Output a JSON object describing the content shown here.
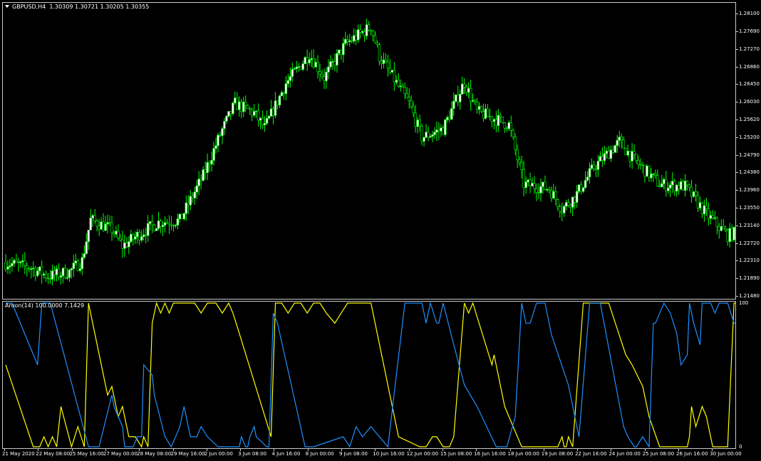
{
  "main_window": {
    "symbol_label": "GBPUSD,H4",
    "ohlc_label": "1.30309 1.30721 1.30205 1.30355"
  },
  "indicator_window": {
    "label": "Aroon(14) 100.0000 7.1429"
  },
  "colors": {
    "background": "#000000",
    "frame": "#c8c8c8",
    "bull_candle": "#ffffff",
    "bear_candle": "#000000",
    "candle_wick": "#00ff00",
    "aroon_up": "#ffff00",
    "aroon_down": "#1e90ff",
    "text": "#ffffff"
  },
  "price_axis": {
    "labels": [
      "1.28100",
      "1.27690",
      "1.27270",
      "1.26860",
      "1.26450",
      "1.26030",
      "1.25620",
      "1.25200",
      "1.24790",
      "1.24380",
      "1.23960",
      "1.23550",
      "1.23140",
      "1.22720",
      "1.22310",
      "1.21890",
      "1.21480"
    ]
  },
  "indicator_axis": {
    "labels": [
      "100",
      "0"
    ]
  },
  "time_axis": {
    "labels": [
      "21 May 2020",
      "22 May 08:00",
      "25 May 16:00",
      "27 May 00:00",
      "28 May 08:00",
      "29 May 16:00",
      "2 Jun 00:00",
      "3 Jun 08:00",
      "4 Jun 16:00",
      "8 Jun 00:00",
      "9 Jun 08:00",
      "10 Jun 16:00",
      "12 Jun 00:00",
      "15 Jun 08:00",
      "16 Jun 16:00",
      "18 Jun 00:00",
      "19 Jun 08:00",
      "22 Jun 16:00",
      "24 Jun 00:00",
      "25 Jun 08:00",
      "26 Jun 16:00",
      "30 Jun 00:00"
    ]
  },
  "chart_data": [
    {
      "type": "candlestick",
      "symbol": "GBPUSD",
      "timeframe": "H4",
      "ylim": [
        1.2148,
        1.2829
      ],
      "anchors": [
        [
          0,
          1.2226
        ],
        [
          12,
          1.2214
        ],
        [
          20,
          1.2194
        ],
        [
          30,
          1.2205
        ],
        [
          36,
          1.2231
        ],
        [
          40,
          1.2327
        ],
        [
          50,
          1.2304
        ],
        [
          55,
          1.2265
        ],
        [
          62,
          1.229
        ],
        [
          72,
          1.2321
        ],
        [
          82,
          1.2325
        ],
        [
          93,
          1.243
        ],
        [
          102,
          1.2538
        ],
        [
          108,
          1.2599
        ],
        [
          117,
          1.2577
        ],
        [
          122,
          1.2542
        ],
        [
          132,
          1.2647
        ],
        [
          143,
          1.2716
        ],
        [
          150,
          1.266
        ],
        [
          160,
          1.2739
        ],
        [
          172,
          1.278
        ],
        [
          176,
          1.271
        ],
        [
          190,
          1.26
        ],
        [
          196,
          1.252
        ],
        [
          206,
          1.254
        ],
        [
          216,
          1.265
        ],
        [
          222,
          1.258
        ],
        [
          237,
          1.255
        ],
        [
          244,
          1.241
        ],
        [
          256,
          1.24
        ],
        [
          262,
          1.2352
        ],
        [
          268,
          1.238
        ],
        [
          277,
          1.245
        ],
        [
          289,
          1.251
        ],
        [
          296,
          1.2467
        ],
        [
          308,
          1.241
        ],
        [
          320,
          1.2405
        ],
        [
          330,
          1.234
        ],
        [
          340,
          1.229
        ],
        [
          344,
          1.2297
        ]
      ]
    },
    {
      "type": "line",
      "name": "Aroon(14)",
      "ylim": [
        0,
        100
      ],
      "current": {
        "up": 100.0,
        "down": 7.1429
      },
      "series": [
        {
          "name": "Aroon Up",
          "points": [
            [
              0,
              57
            ],
            [
              13,
              0
            ],
            [
              16,
              0
            ],
            [
              18,
              7
            ],
            [
              20,
              0
            ],
            [
              22,
              7
            ],
            [
              24,
              0
            ],
            [
              26,
              28
            ],
            [
              31,
              0
            ],
            [
              34,
              14
            ],
            [
              37,
              0
            ],
            [
              39,
              100
            ],
            [
              48,
              36
            ],
            [
              50,
              42
            ],
            [
              53,
              21
            ],
            [
              55,
              28
            ],
            [
              58,
              7
            ],
            [
              61,
              7
            ],
            [
              64,
              0
            ],
            [
              65,
              7
            ],
            [
              67,
              0
            ],
            [
              69,
              86
            ],
            [
              71,
              100
            ],
            [
              73,
              93
            ],
            [
              75,
              100
            ],
            [
              77,
              93
            ],
            [
              79,
              100
            ],
            [
              81,
              100
            ],
            [
              83,
              100
            ],
            [
              85,
              100
            ],
            [
              89,
              100
            ],
            [
              92,
              93
            ],
            [
              95,
              100
            ],
            [
              99,
              100
            ],
            [
              102,
              93
            ],
            [
              105,
              100
            ],
            [
              107,
              93
            ],
            [
              110,
              79
            ],
            [
              125,
              7
            ],
            [
              127,
              100
            ],
            [
              130,
              100
            ],
            [
              133,
              93
            ],
            [
              136,
              100
            ],
            [
              139,
              100
            ],
            [
              142,
              93
            ],
            [
              145,
              100
            ],
            [
              148,
              100
            ],
            [
              151,
              93
            ],
            [
              155,
              86
            ],
            [
              158,
              93
            ],
            [
              161,
              100
            ],
            [
              164,
              100
            ],
            [
              171,
              100
            ],
            [
              172,
              100
            ],
            [
              185,
              7
            ],
            [
              195,
              0
            ],
            [
              198,
              0
            ],
            [
              201,
              7
            ],
            [
              203,
              7
            ],
            [
              206,
              0
            ],
            [
              209,
              0
            ],
            [
              211,
              7
            ],
            [
              216,
              100
            ],
            [
              218,
              93
            ],
            [
              220,
              100
            ],
            [
              229,
              57
            ],
            [
              230,
              64
            ],
            [
              235,
              28
            ],
            [
              243,
              0
            ],
            [
              255,
              0
            ],
            [
              260,
              0
            ],
            [
              262,
              7
            ],
            [
              263,
              0
            ],
            [
              264,
              0
            ],
            [
              265,
              7
            ],
            [
              267,
              0
            ],
            [
              272,
              100
            ],
            [
              273,
              100
            ],
            [
              275,
              100
            ],
            [
              284,
              100
            ],
            [
              292,
              64
            ],
            [
              295,
              57
            ],
            [
              300,
              42
            ],
            [
              303,
              21
            ],
            [
              308,
              0
            ],
            [
              318,
              0
            ],
            [
              321,
              0
            ],
            [
              322,
              7
            ],
            [
              323,
              28
            ],
            [
              325,
              14
            ],
            [
              328,
              28
            ],
            [
              330,
              21
            ],
            [
              333,
              0
            ],
            [
              336,
              0
            ],
            [
              340,
              0
            ],
            [
              343,
              100
            ],
            [
              344,
              100
            ]
          ]
        },
        {
          "name": "Aroon Down",
          "points": [
            [
              0,
              100
            ],
            [
              3,
              100
            ],
            [
              15,
              57
            ],
            [
              17,
              100
            ],
            [
              21,
              100
            ],
            [
              39,
              0
            ],
            [
              44,
              0
            ],
            [
              50,
              36
            ],
            [
              51,
              28
            ],
            [
              55,
              14
            ],
            [
              56,
              0
            ],
            [
              60,
              0
            ],
            [
              62,
              7
            ],
            [
              64,
              7
            ],
            [
              65,
              57
            ],
            [
              69,
              50
            ],
            [
              70,
              36
            ],
            [
              75,
              7
            ],
            [
              78,
              0
            ],
            [
              82,
              14
            ],
            [
              84,
              28
            ],
            [
              87,
              7
            ],
            [
              90,
              7
            ],
            [
              92,
              14
            ],
            [
              95,
              7
            ],
            [
              100,
              0
            ],
            [
              102,
              0
            ],
            [
              106,
              0
            ],
            [
              110,
              0
            ],
            [
              111,
              7
            ],
            [
              113,
              0
            ],
            [
              114,
              0
            ],
            [
              115,
              7
            ],
            [
              117,
              14
            ],
            [
              118,
              7
            ],
            [
              123,
              0
            ],
            [
              124,
              0
            ],
            [
              126,
              93
            ],
            [
              128,
              86
            ],
            [
              141,
              0
            ],
            [
              145,
              0
            ],
            [
              159,
              7
            ],
            [
              162,
              0
            ],
            [
              165,
              14
            ],
            [
              168,
              7
            ],
            [
              172,
              14
            ],
            [
              180,
              0
            ],
            [
              188,
              100
            ],
            [
              192,
              100
            ],
            [
              196,
              100
            ],
            [
              198,
              86
            ],
            [
              200,
              100
            ],
            [
              203,
              86
            ],
            [
              204,
              86
            ],
            [
              206,
              100
            ],
            [
              211,
              71
            ],
            [
              216,
              43
            ],
            [
              222,
              28
            ],
            [
              231,
              0
            ],
            [
              236,
              0
            ],
            [
              240,
              21
            ],
            [
              243,
              100
            ],
            [
              245,
              86
            ],
            [
              247,
              86
            ],
            [
              250,
              100
            ],
            [
              254,
              100
            ],
            [
              257,
              78
            ],
            [
              265,
              43
            ],
            [
              269,
              14
            ],
            [
              270,
              7
            ],
            [
              275,
              100
            ],
            [
              280,
              100
            ],
            [
              291,
              14
            ],
            [
              293,
              7
            ],
            [
              296,
              0
            ],
            [
              297,
              0
            ],
            [
              300,
              7
            ],
            [
              303,
              0
            ],
            [
              305,
              86
            ],
            [
              306,
              86
            ],
            [
              310,
              100
            ],
            [
              313,
              93
            ],
            [
              316,
              79
            ],
            [
              318,
              57
            ],
            [
              321,
              64
            ],
            [
              322,
              100
            ],
            [
              324,
              86
            ],
            [
              327,
              71
            ],
            [
              328,
              100
            ],
            [
              332,
              100
            ],
            [
              334,
              93
            ],
            [
              336,
              100
            ],
            [
              340,
              100
            ],
            [
              343,
              86
            ],
            [
              344,
              86
            ]
          ]
        }
      ]
    }
  ]
}
